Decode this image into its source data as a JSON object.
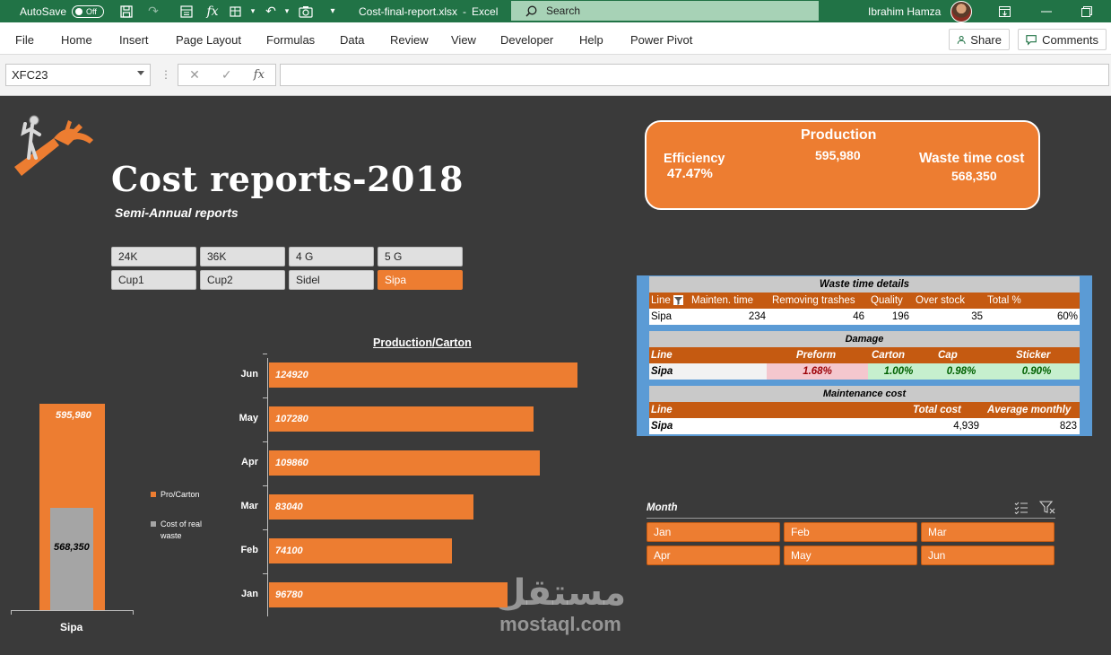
{
  "titlebar": {
    "autosave_label": "AutoSave",
    "autosave_state": "Off",
    "file_name": "Cost-final-report.xlsx",
    "separator": "-",
    "app_name": "Excel",
    "search_placeholder": "Search",
    "user_name": "Ibrahim Hamza"
  },
  "ribbon": {
    "tabs": [
      "File",
      "Home",
      "Insert",
      "Page Layout",
      "Formulas",
      "Data",
      "Review",
      "View",
      "Developer",
      "Help",
      "Power Pivot"
    ],
    "share_label": "Share",
    "comments_label": "Comments"
  },
  "formula_bar": {
    "name_box": "XFC23",
    "formula": ""
  },
  "dashboard": {
    "title": "Cost reports-2018",
    "subtitle": "Semi-Annual reports",
    "line_slicer": [
      "24K",
      "36K",
      "4 G",
      "5 G",
      "Cup1",
      "Cup2",
      "Sidel",
      "Sipa"
    ],
    "line_slicer_selected": "Sipa",
    "kpi": {
      "production_label": "Production",
      "production_value": "595,980",
      "efficiency_label": "Efficiency",
      "efficiency_value": "47.47%",
      "waste_label": "Waste time cost",
      "waste_value": "568,350"
    },
    "waste_table": {
      "title": "Waste time details",
      "headers": [
        "Line",
        "Mainten. time",
        "Removing trashes",
        "Quality",
        "Over stock",
        "Total %"
      ],
      "row": [
        "Sipa",
        "234",
        "46",
        "196",
        "35",
        "60%"
      ]
    },
    "damage_table": {
      "title": "Damage",
      "headers": [
        "Line",
        "Preform",
        "Carton",
        "Cap",
        "Sticker"
      ],
      "row": [
        "Sipa",
        "1.68%",
        "1.00%",
        "0.98%",
        "0.90%"
      ]
    },
    "maintenance_table": {
      "title": "Maintenance cost",
      "headers": [
        "Line",
        "Total cost",
        "Average monthly"
      ],
      "row": [
        "Sipa",
        "4,939",
        "823"
      ]
    },
    "month_slicer": {
      "title": "Month",
      "items": [
        "Jan",
        "Feb",
        "Mar",
        "Apr",
        "May",
        "Jun"
      ]
    },
    "watermark": {
      "arabic": "مستقل",
      "latin": "mostaql.com"
    },
    "colors": {
      "accent": "#ed7d31",
      "accent_dark": "#c55a11",
      "background": "#3a3a3a",
      "gray_series": "#a5a5a5",
      "excel_green": "#217346"
    }
  },
  "chart_data": [
    {
      "type": "bar",
      "orientation": "horizontal",
      "title": "Production/Carton",
      "categories": [
        "Jun",
        "May",
        "Apr",
        "Mar",
        "Feb",
        "Jan"
      ],
      "values": [
        124920,
        107280,
        109860,
        83040,
        74100,
        96780
      ],
      "xlim": [
        0,
        160000
      ]
    },
    {
      "type": "bar",
      "orientation": "vertical",
      "categories": [
        "Sipa"
      ],
      "series": [
        {
          "name": "Pro/Carton",
          "values": [
            595980
          ],
          "color": "#ed7d31"
        },
        {
          "name": "Cost of real waste",
          "values": [
            568350
          ],
          "color": "#a5a5a5"
        }
      ],
      "data_labels": [
        "595,980",
        "568,350"
      ],
      "ylim": [
        0,
        595980
      ],
      "legend": "right"
    }
  ]
}
